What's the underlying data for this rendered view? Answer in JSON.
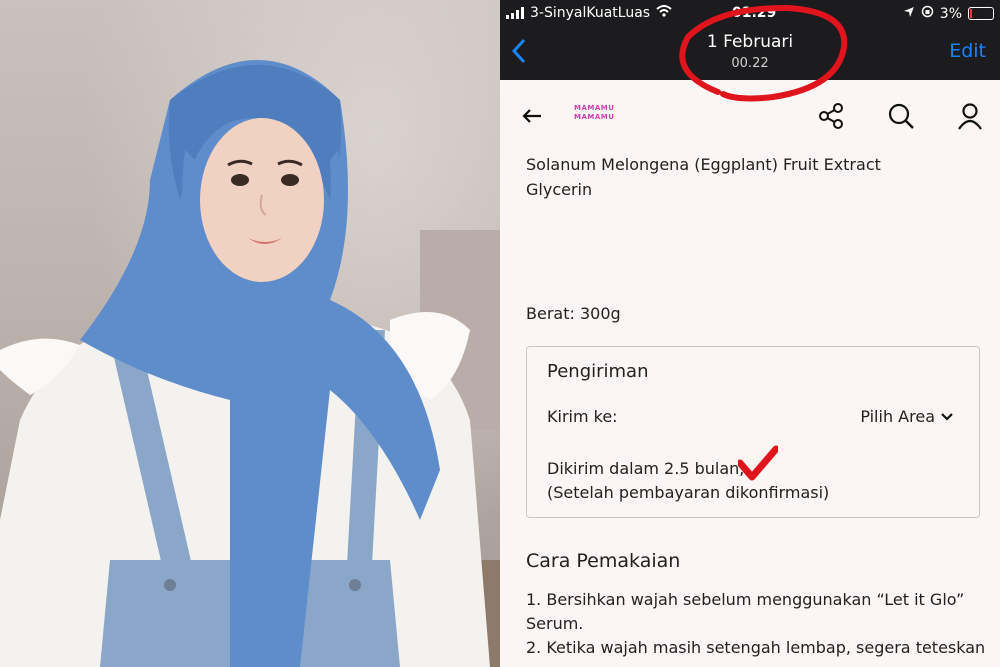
{
  "photo": {
    "description_icon": "woman-in-hijab-photo"
  },
  "status_bar": {
    "carrier": "3-SinyalKuatLuas",
    "time": "01.29",
    "battery": "3%"
  },
  "nav": {
    "back_icon": "chevron-left-icon",
    "title": "1 Februari",
    "subtitle": "00.22",
    "edit_label": "Edit"
  },
  "app_header": {
    "logo_text": "MAMAMU MAMAMU",
    "icons": [
      "share-icon",
      "search-icon",
      "user-icon"
    ]
  },
  "ingredients": [
    "Solanum Melongena (Eggplant) Fruit Extract",
    "Glycerin"
  ],
  "weight": "Berat: 300g",
  "shipping": {
    "heading": "Pengiriman",
    "send_to_label": "Kirim ke:",
    "area_select": "Pilih Area",
    "delivery_line1": "Dikirim dalam 2.5 bulan,",
    "delivery_line2": "(Setelah pembayaran dikonfirmasi)"
  },
  "usage": {
    "heading": "Cara Pemakaian",
    "steps": [
      "1. Bersihkan wajah sebelum menggunakan “Let it Glo”",
      "Serum.",
      "2. Ketika wajah masih setengah lembap, segera teteskan"
    ]
  },
  "colors": {
    "accent": "#1a82ff",
    "annotation": "#e0141c",
    "background": "#fbf5f4"
  }
}
